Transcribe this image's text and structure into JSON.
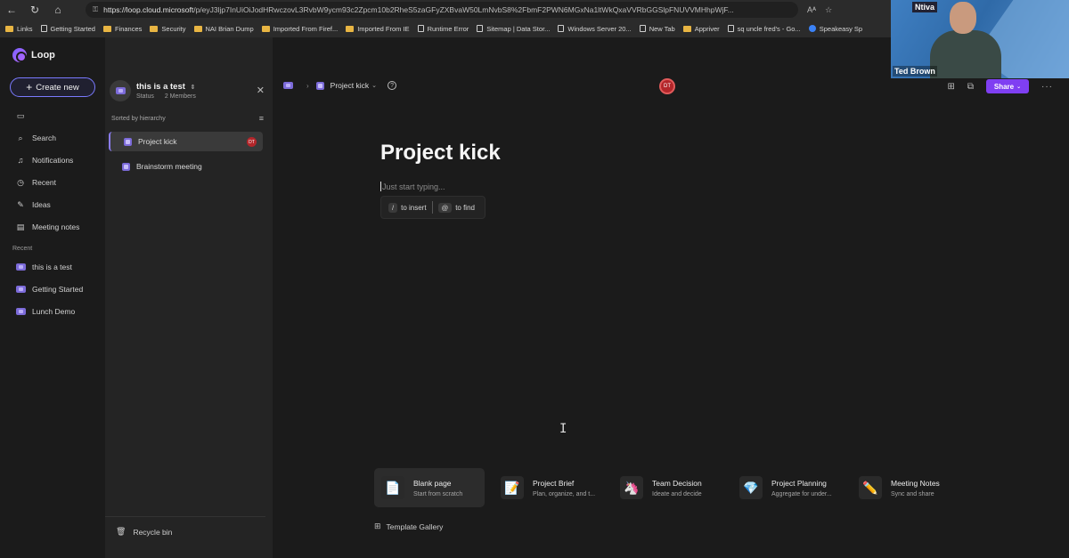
{
  "browser": {
    "url_host": "https://loop.cloud.microsoft",
    "url_path": "/p/eyJ3ljp7InUiOiJodHRwczovL3RvbW9ycm93c2Zpcm10b2RheS5zaGFyZXBvaW50LmNvbS8%2FbmF2PWN6MGxNa1ltWkQxaVVRbGGSlpFNUVVMHhpWjF...",
    "bookmarks": [
      {
        "label": "Links",
        "icon": "folder"
      },
      {
        "label": "Getting Started",
        "icon": "page"
      },
      {
        "label": "Finances",
        "icon": "folder"
      },
      {
        "label": "Security",
        "icon": "folder"
      },
      {
        "label": "NAI Brian Dump",
        "icon": "folder"
      },
      {
        "label": "Imported From Firef...",
        "icon": "folder"
      },
      {
        "label": "Imported From IE",
        "icon": "folder"
      },
      {
        "label": "Runtime Error",
        "icon": "page"
      },
      {
        "label": "Sitemap | Data Stor...",
        "icon": "page"
      },
      {
        "label": "Windows Server 20...",
        "icon": "page"
      },
      {
        "label": "New Tab",
        "icon": "page"
      },
      {
        "label": "Appriver",
        "icon": "folder"
      },
      {
        "label": "sq uncle fred's - Go...",
        "icon": "page"
      },
      {
        "label": "Speakeasy Sp",
        "icon": "globe"
      }
    ]
  },
  "app": {
    "name": "Loop",
    "create_label": "Create new",
    "nav": [
      {
        "label": "",
        "icon": "home-icon"
      },
      {
        "label": "Search",
        "icon": "search-icon"
      },
      {
        "label": "Notifications",
        "icon": "bell-icon"
      },
      {
        "label": "Recent",
        "icon": "clock-icon"
      },
      {
        "label": "Ideas",
        "icon": "ideas-icon"
      },
      {
        "label": "Meeting notes",
        "icon": "notes-icon"
      }
    ],
    "recent_header": "Recent",
    "recent": [
      "this is a test",
      "Getting Started",
      "Lunch Demo"
    ]
  },
  "workspace": {
    "title": "this is a test",
    "status": "Status",
    "members": "2 Members",
    "sorted_label": "Sorted by hierarchy",
    "pages": [
      {
        "label": "Project kick",
        "badge": "DT"
      },
      {
        "label": "Brainstorm meeting",
        "badge": ""
      }
    ],
    "recycle_label": "Recycle bin"
  },
  "doc": {
    "breadcrumb": "Project kick",
    "presence_initials": "DT",
    "share_label": "Share",
    "title": "Project kick",
    "placeholder": "Just start typing...",
    "hint_insert_key": "/",
    "hint_insert_label": "to insert",
    "hint_find_key": "@",
    "hint_find_label": "to find",
    "templates": [
      {
        "name": "Blank page",
        "desc": "Start from scratch",
        "icon": "📄"
      },
      {
        "name": "Project Brief",
        "desc": "Plan, organize, and t...",
        "icon": "📝"
      },
      {
        "name": "Team Decision",
        "desc": "Ideate and decide",
        "icon": "🦄"
      },
      {
        "name": "Project Planning",
        "desc": "Aggregate for under...",
        "icon": "💎"
      },
      {
        "name": "Meeting Notes",
        "desc": "Sync and share",
        "icon": "✏️"
      }
    ],
    "gallery_label": "Template Gallery"
  },
  "webcam": {
    "brand": "Ntiva",
    "person_name": "Ted Brown"
  },
  "colors": {
    "accent": "#7f3ff2",
    "create_border": "#7a7aff",
    "presence": "#b3262a"
  }
}
